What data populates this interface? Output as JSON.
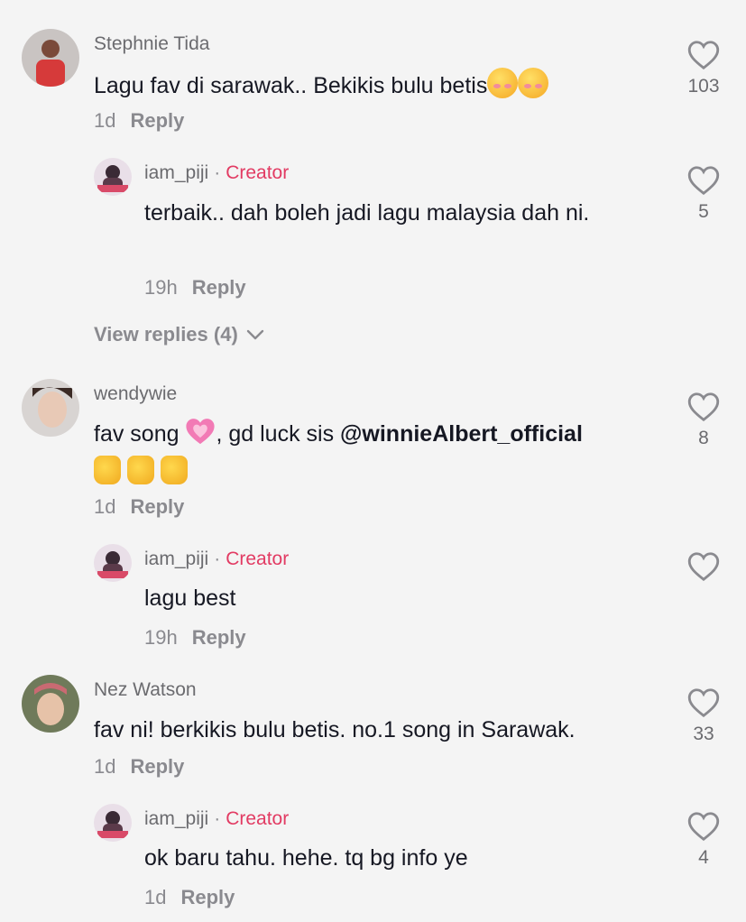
{
  "comments": [
    {
      "username": "Stephnie Tida",
      "text": "Lagu fav di sarawak.. Bekikis bulu betis",
      "emojis": [
        "smiling-face-with-hearts",
        "smiling-face-with-hearts"
      ],
      "time": "1d",
      "reply_label": "Reply",
      "likes": "103"
    },
    {
      "username": "iam_piji",
      "dot": "·",
      "badge": "Creator",
      "text": "terbaik.. dah boleh jadi lagu malaysia dah ni.",
      "time": "19h",
      "reply_label": "Reply",
      "likes": "5"
    },
    {
      "view_replies": "View replies (4)"
    },
    {
      "username": "wendywie",
      "text_before": "fav song",
      "text_after": ", gd luck sis",
      "mention": "@winnieAlbert_official",
      "emojis": [
        "growing-heart",
        "thumbs-up",
        "thumbs-up",
        "thumbs-up"
      ],
      "time": "1d",
      "reply_label": "Reply",
      "likes": "8"
    },
    {
      "username": "iam_piji",
      "dot": "·",
      "badge": "Creator",
      "text": "lagu best",
      "time": "19h",
      "reply_label": "Reply",
      "likes": ""
    },
    {
      "username": "Nez Watson",
      "text": "fav ni! berkikis bulu betis. no.1 song in Sarawak.",
      "time": "1d",
      "reply_label": "Reply",
      "likes": "33"
    },
    {
      "username": "iam_piji",
      "dot": "·",
      "badge": "Creator",
      "text": "ok baru tahu. hehe. tq bg info ye",
      "time": "1d",
      "reply_label": "Reply",
      "likes": "4"
    }
  ],
  "colors": {
    "background": "#f4f4f4",
    "creator_badge": "#e23b63",
    "muted": "#8a8a8f"
  },
  "icons": [
    "heart-outline-icon",
    "chevron-down-icon"
  ]
}
